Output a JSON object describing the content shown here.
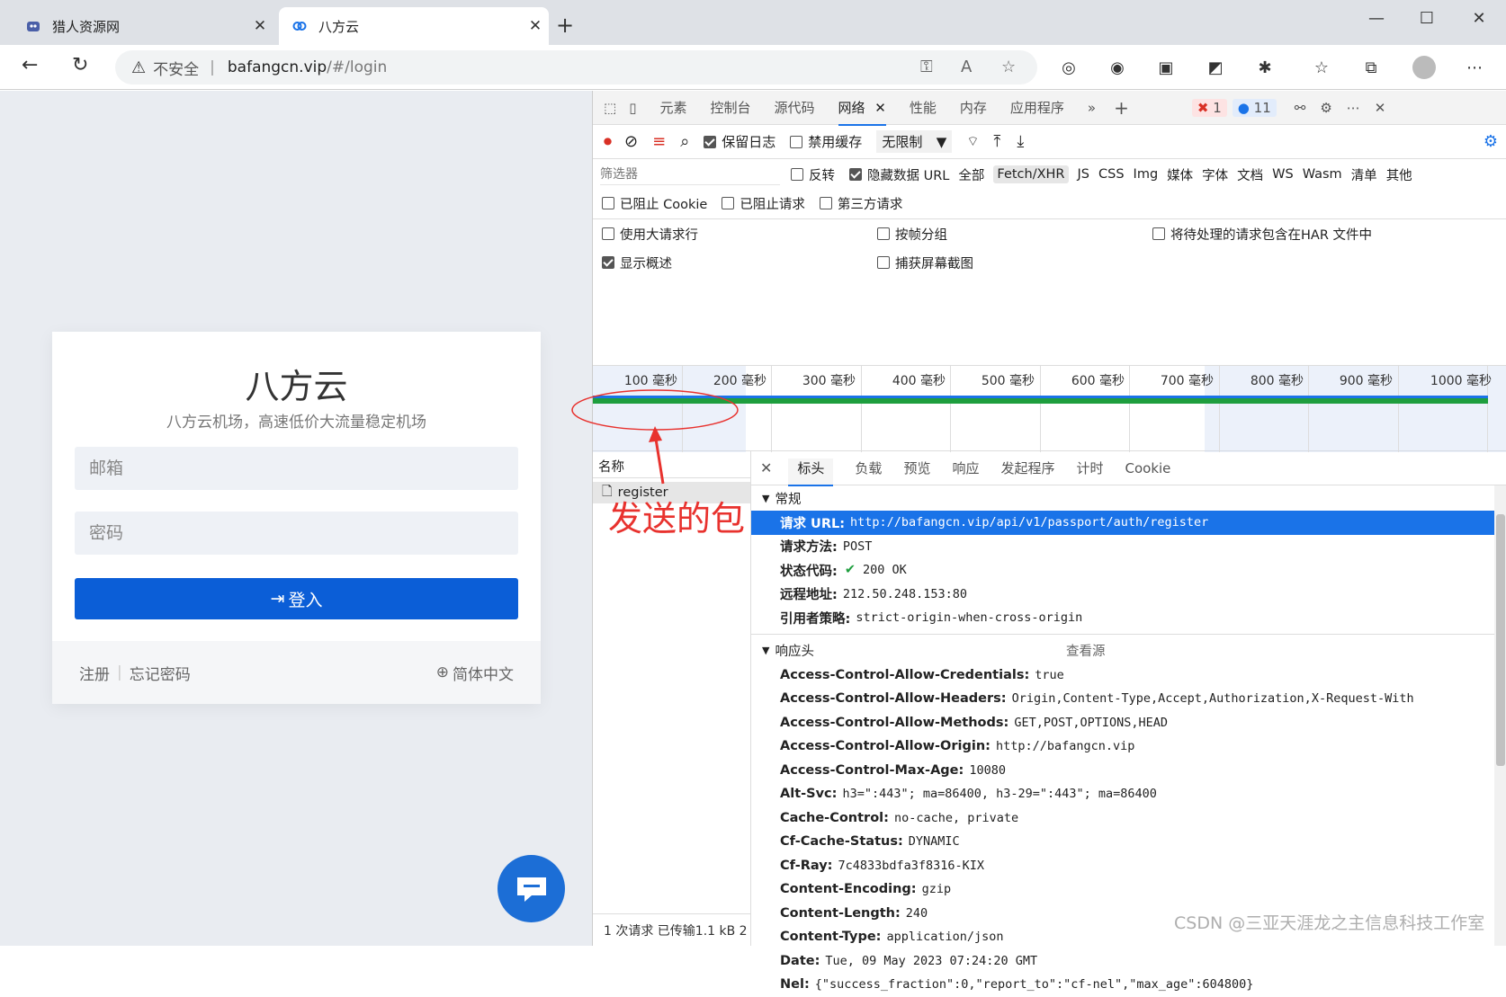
{
  "browser": {
    "tabs": [
      {
        "title": "猎人资源网"
      },
      {
        "title": "八方云"
      }
    ],
    "address": {
      "security_label": "不安全",
      "url_host": "bafangcn.vip",
      "url_path": "/#/login"
    }
  },
  "login_page": {
    "title": "八方云",
    "subtitle": "八方云机场，高速低价大流量稳定机场",
    "email_placeholder": "邮箱",
    "password_placeholder": "密码",
    "login_label": "登入",
    "register_link": "注册",
    "forgot_link": "忘记密码",
    "language": "简体中文"
  },
  "devtools": {
    "panels": [
      "元素",
      "控制台",
      "源代码",
      "网络",
      "性能",
      "内存",
      "应用程序"
    ],
    "active_panel": "网络",
    "error_count": "1",
    "message_count": "11",
    "toolbar": {
      "preserve_log": "保留日志",
      "disable_cache": "禁用缓存",
      "throttling": "无限制"
    },
    "filter": {
      "placeholder": "筛选器",
      "invert": "反转",
      "hide_data_urls": "隐藏数据 URL",
      "types": [
        "全部",
        "Fetch/XHR",
        "JS",
        "CSS",
        "Img",
        "媒体",
        "字体",
        "文档",
        "WS",
        "Wasm",
        "清单",
        "其他"
      ],
      "blocked_cookies": "已阻止 Cookie",
      "blocked_requests": "已阻止请求",
      "third_party": "第三方请求"
    },
    "options": {
      "large_rows": "使用大请求行",
      "group_by_frame": "按帧分组",
      "har_pending": "将待处理的请求包含在HAR 文件中",
      "overview": "显示概述",
      "screenshots": "捕获屏幕截图"
    },
    "timeline_labels": [
      "100 毫秒",
      "200 毫秒",
      "300 毫秒",
      "400 毫秒",
      "500 毫秒",
      "600 毫秒",
      "700 毫秒",
      "800 毫秒",
      "900 毫秒",
      "1000 毫秒"
    ],
    "request_list": {
      "header": "名称",
      "items": [
        "register"
      ],
      "status": "1 次请求  已传输1.1 kB  2"
    },
    "detail_tabs": [
      "标头",
      "负载",
      "预览",
      "响应",
      "发起程序",
      "计时",
      "Cookie"
    ],
    "general": {
      "title": "常规",
      "rows": [
        {
          "k": "请求 URL:",
          "v": "http://bafangcn.vip/api/v1/passport/auth/register"
        },
        {
          "k": "请求方法:",
          "v": "POST"
        },
        {
          "k": "状态代码:",
          "v": "200 OK"
        },
        {
          "k": "远程地址:",
          "v": "212.50.248.153:80"
        },
        {
          "k": "引用者策略:",
          "v": "strict-origin-when-cross-origin"
        }
      ]
    },
    "response_headers": {
      "title": "响应头",
      "view_source": "查看源",
      "rows": [
        {
          "k": "Access-Control-Allow-Credentials:",
          "v": "true"
        },
        {
          "k": "Access-Control-Allow-Headers:",
          "v": "Origin,Content-Type,Accept,Authorization,X-Request-With"
        },
        {
          "k": "Access-Control-Allow-Methods:",
          "v": "GET,POST,OPTIONS,HEAD"
        },
        {
          "k": "Access-Control-Allow-Origin:",
          "v": "http://bafangcn.vip"
        },
        {
          "k": "Access-Control-Max-Age:",
          "v": "10080"
        },
        {
          "k": "Alt-Svc:",
          "v": "h3=\":443\"; ma=86400, h3-29=\":443\"; ma=86400"
        },
        {
          "k": "Cache-Control:",
          "v": "no-cache, private"
        },
        {
          "k": "Cf-Cache-Status:",
          "v": "DYNAMIC"
        },
        {
          "k": "Cf-Ray:",
          "v": "7c4833bdfa3f8316-KIX"
        },
        {
          "k": "Content-Encoding:",
          "v": "gzip"
        },
        {
          "k": "Content-Length:",
          "v": "240"
        },
        {
          "k": "Content-Type:",
          "v": "application/json"
        },
        {
          "k": "Date:",
          "v": "Tue, 09 May 2023 07:24:20 GMT"
        },
        {
          "k": "Nel:",
          "v": "{\"success_fraction\":0,\"report_to\":\"cf-nel\",\"max_age\":604800}"
        }
      ]
    }
  },
  "annotation": "发送的包",
  "watermark": "CSDN @三亚天涯龙之主信息科技工作室"
}
